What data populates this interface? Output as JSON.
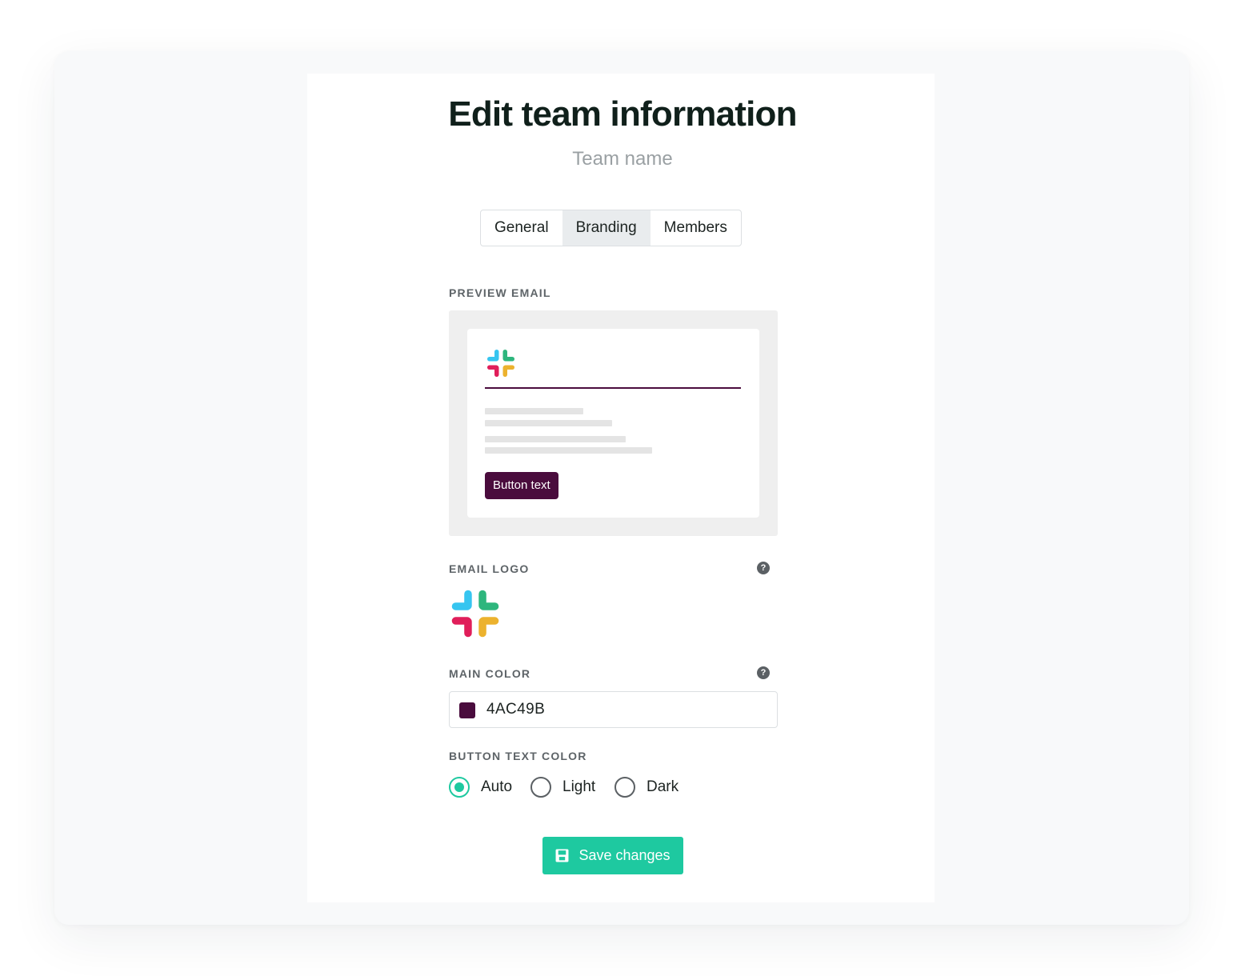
{
  "page": {
    "title": "Edit team information",
    "subtitle": "Team name"
  },
  "tabs": [
    {
      "label": "General",
      "active": false
    },
    {
      "label": "Branding",
      "active": true
    },
    {
      "label": "Members",
      "active": false
    }
  ],
  "preview": {
    "label": "PREVIEW EMAIL",
    "button_text": "Button text",
    "logo_icon": "slack-logo-icon"
  },
  "email_logo": {
    "label": "EMAIL LOGO",
    "help_icon": "question-circle-icon",
    "logo_icon": "slack-logo-icon"
  },
  "main_color": {
    "label": "MAIN COLOR",
    "help_icon": "question-circle-icon",
    "value": "4AC49B",
    "swatch_color": "#4a0c3d"
  },
  "button_text_color": {
    "label": "BUTTON TEXT COLOR",
    "options": [
      {
        "label": "Auto",
        "checked": true
      },
      {
        "label": "Light",
        "checked": false
      },
      {
        "label": "Dark",
        "checked": false
      }
    ]
  },
  "save_button": {
    "label": "Save changes",
    "icon": "floppy-disk-icon"
  },
  "colors": {
    "accent": "#1ec9a0",
    "brand": "#4a0c3d"
  }
}
